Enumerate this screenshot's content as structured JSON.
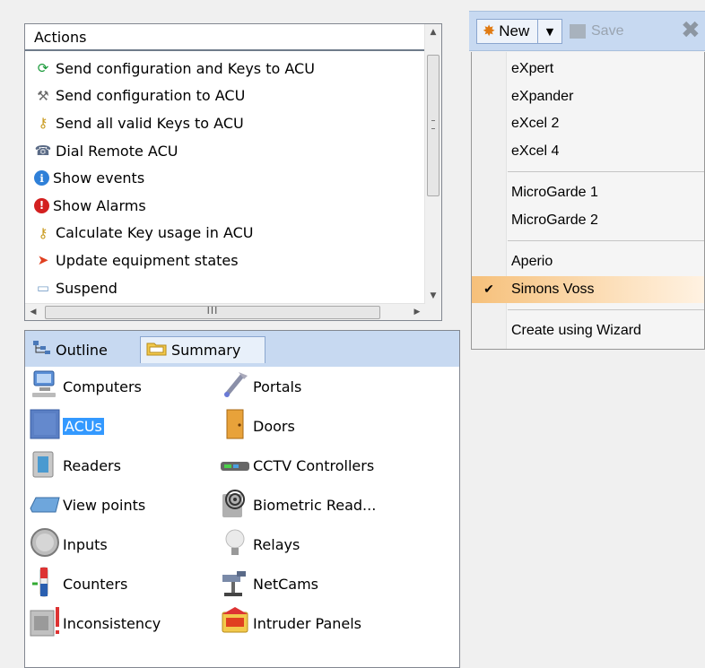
{
  "actions": {
    "title": "Actions",
    "items": [
      {
        "label": "Send configuration and Keys to ACU",
        "icon": "refresh-icon",
        "color": "#1a9a3a"
      },
      {
        "label": "Send configuration to ACU",
        "icon": "tools-icon",
        "color": "#6a6a6a"
      },
      {
        "label": "Send all valid Keys to ACU",
        "icon": "key-icon",
        "color": "#c99a1e"
      },
      {
        "label": "Dial Remote ACU",
        "icon": "phone-icon",
        "color": "#5b6b86"
      },
      {
        "label": "Show events",
        "icon": "info-icon",
        "color": "#2f80d8"
      },
      {
        "label": "Show Alarms",
        "icon": "alarm-icon",
        "color": "#d32020"
      },
      {
        "label": "Calculate Key usage in ACU",
        "icon": "key-icon",
        "color": "#c99a1e"
      },
      {
        "label": "Update equipment states",
        "icon": "update-icon",
        "color": "#e04020"
      },
      {
        "label": "Suspend",
        "icon": "suspend-icon",
        "color": "#7aa0c8"
      }
    ],
    "hscroll_grip": "III"
  },
  "outline": {
    "tabs": [
      {
        "label": "Outline",
        "icon": "tree-icon"
      },
      {
        "label": "Summary",
        "icon": "folder-icon"
      }
    ],
    "items": [
      {
        "label": "Computers",
        "icon": "computer-icon"
      },
      {
        "label": "Portals",
        "icon": "portal-icon"
      },
      {
        "label": "ACUs",
        "icon": "acu-icon",
        "selected": true
      },
      {
        "label": "Doors",
        "icon": "door-icon"
      },
      {
        "label": "Readers",
        "icon": "reader-icon"
      },
      {
        "label": "CCTV Controllers",
        "icon": "cctv-icon"
      },
      {
        "label": "View points",
        "icon": "viewpoint-icon"
      },
      {
        "label": "Biometric Read...",
        "icon": "fingerprint-icon"
      },
      {
        "label": "Inputs",
        "icon": "input-icon"
      },
      {
        "label": "Relays",
        "icon": "bulb-icon"
      },
      {
        "label": "Counters",
        "icon": "counter-icon"
      },
      {
        "label": "NetCams",
        "icon": "netcam-icon"
      },
      {
        "label": "Inconsistency",
        "icon": "inconsistency-icon"
      },
      {
        "label": "Intruder Panels",
        "icon": "intruder-icon"
      }
    ]
  },
  "toolbar": {
    "new_label": "New",
    "save_label": "Save"
  },
  "dropdown": {
    "groups": [
      [
        "eXpert",
        "eXpander",
        "eXcel 2",
        "eXcel 4"
      ],
      [
        "MicroGarde 1",
        "MicroGarde 2"
      ],
      [
        "Aperio",
        "Simons Voss"
      ],
      [
        "Create using Wizard"
      ]
    ],
    "checked_item": "Simons Voss",
    "check_mark": "✔",
    "highlight_color": "#f6c07a"
  }
}
